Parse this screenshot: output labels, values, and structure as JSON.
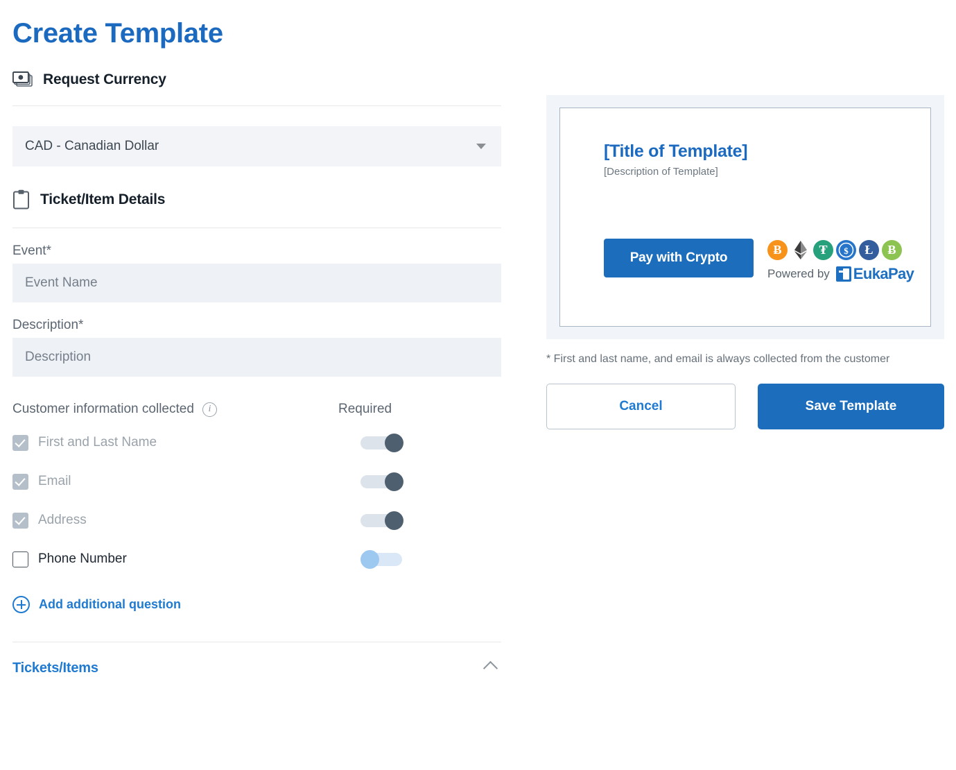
{
  "page_title": "Create Template",
  "accent_colors": {
    "brand_blue": "#1b6ac0",
    "button_blue": "#1c6dbb",
    "link_blue": "#1f7ad1",
    "toggle_on": "#4e5f6f",
    "toggle_off": "#9dc8f0"
  },
  "currency_section": {
    "icon": "money-stack-icon",
    "heading": "Request Currency",
    "select": {
      "value": "CAD - Canadian Dollar",
      "caret_icon": "chevron-down-icon"
    }
  },
  "ticket_section": {
    "icon": "clipboard-icon",
    "heading": "Ticket/Item Details",
    "fields": [
      {
        "label": "Event*",
        "placeholder": "Event Name",
        "value": ""
      },
      {
        "label": "Description*",
        "placeholder": "Description",
        "value": ""
      }
    ],
    "collected": {
      "label": "Customer information collected",
      "info_icon": "info-icon",
      "required_label": "Required",
      "rows": [
        {
          "label": "First and Last Name",
          "checked": true,
          "disabled": true,
          "toggle": "on"
        },
        {
          "label": "Email",
          "checked": true,
          "disabled": true,
          "toggle": "on"
        },
        {
          "label": "Address",
          "checked": true,
          "disabled": true,
          "toggle": "on"
        },
        {
          "label": "Phone Number",
          "checked": false,
          "disabled": false,
          "toggle": "off"
        }
      ]
    },
    "add_question": {
      "icon": "plus-circle-icon",
      "label": "Add additional question"
    }
  },
  "tickets_items": {
    "label": "Tickets/Items",
    "chevron_icon": "chevron-up-icon"
  },
  "preview": {
    "template_title": "[Title of Template]",
    "template_description": "[Description of Template]",
    "pay_button": "Pay with Crypto",
    "powered_by": "Powered by",
    "brand_name": "EukaPay",
    "coins": [
      {
        "name": "bitcoin-icon",
        "symbol": "Ƀ",
        "color": "#f7931a"
      },
      {
        "name": "ethereum-icon",
        "symbol": "",
        "color": "#3c3c3d"
      },
      {
        "name": "tether-icon",
        "symbol": "₮",
        "color": "#26a17b"
      },
      {
        "name": "usd-coin-icon",
        "symbol": "$",
        "color": "#2775ca"
      },
      {
        "name": "litecoin-icon",
        "symbol": "Ł",
        "color": "#345d9d"
      },
      {
        "name": "bitcoin-cash-icon",
        "symbol": "Ƀ",
        "color": "#8dc351"
      }
    ]
  },
  "footer": {
    "note": "* First and last name, and email is always collected from the customer",
    "cancel_label": "Cancel",
    "save_label": "Save Template"
  }
}
